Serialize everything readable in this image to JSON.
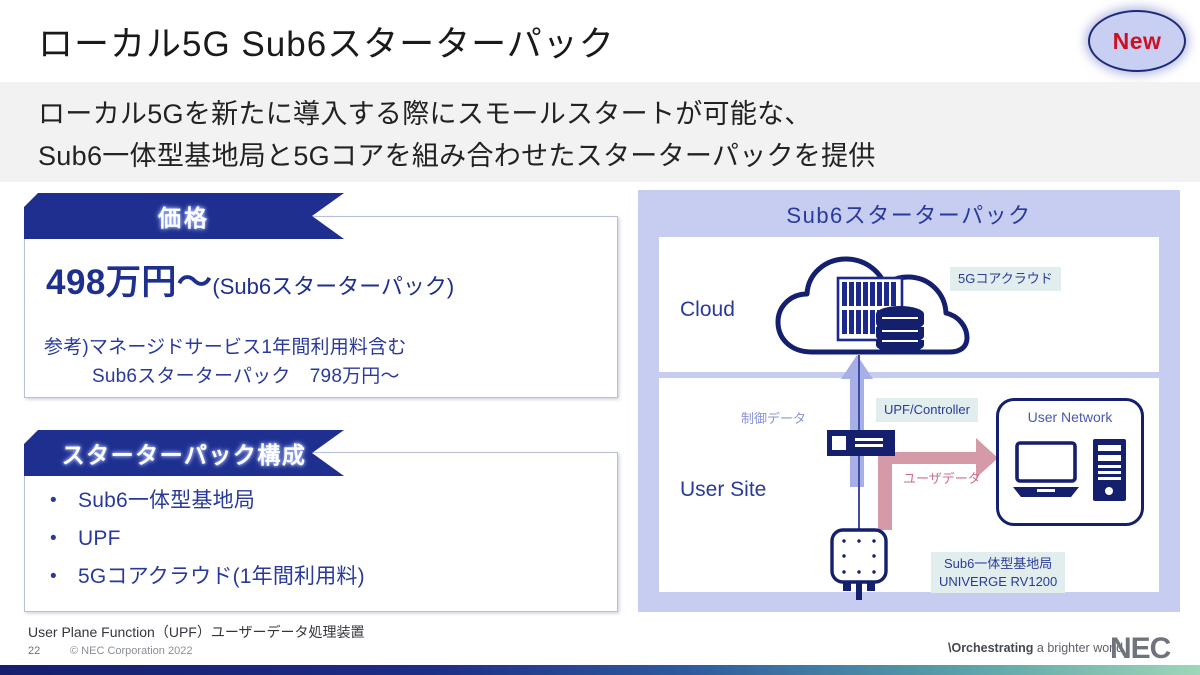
{
  "slide": {
    "title": "ローカル5G Sub6スターターパック",
    "badge": "New",
    "subtitle_line1": "ローカル5Gを新たに導入する際にスモールスタートが可能な、",
    "subtitle_line2": "Sub6一体型基地局と5Gコアを組み合わせたスターターパックを提供"
  },
  "price_section": {
    "banner": "価格",
    "main_amount": "498万円〜",
    "main_paren": "(Sub6スターターパック)",
    "note_line1": "参考)マネージドサービス1年間利用料含む",
    "note_line2": "Sub6スターターパック　798万円〜"
  },
  "composition_section": {
    "banner": "スターターパック構成",
    "bullet": "•",
    "items": [
      "Sub6一体型基地局",
      "UPF",
      "5Gコアクラウド(1年間利用料)"
    ]
  },
  "diagram": {
    "title": "Sub6スターターパック",
    "cloud_label": "Cloud",
    "site_label": "User Site",
    "tag_core_cloud": "5Gコアクラウド",
    "tag_upf_controller": "UPF/Controller",
    "tag_station_line1": "Sub6一体型基地局",
    "tag_station_line2": "UNIVERGE RV1200",
    "label_control_data": "制御データ",
    "label_user_data": "ユーザデータ",
    "user_network_title": "User Network"
  },
  "footer": {
    "footnote": "User Plane Function（UPF）ユーザーデータ処理装置",
    "page_number": "22",
    "copyright": "© NEC Corporation 2022",
    "tagline_prefix": "\\Orchestrating",
    "tagline_rest": " a brighter world",
    "logo": "NEC"
  },
  "colors": {
    "navy": "#1e2f8f",
    "deep_navy": "#141f6e",
    "panel_bg": "#c7cdf0",
    "tag_bg": "#e2eeee",
    "band_bg": "#f2f2f2",
    "control_arrow": "#a7b0e6",
    "user_arrow": "#d49aa8",
    "badge_text": "#cc1122"
  }
}
